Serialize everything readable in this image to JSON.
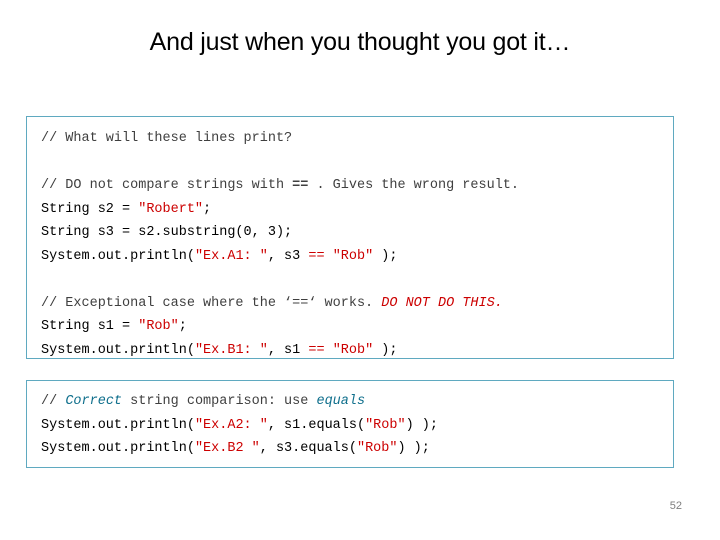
{
  "slide": {
    "title": "And just when you thought you got it…",
    "page_number": "52",
    "border_color": "#5fa9c0",
    "comment_color": "#1f7a1f",
    "string_color": "#cc0000",
    "keyword_color": "#0f6f8c"
  },
  "code_block_1": {
    "line_1": "// What will these lines print?",
    "line_2_a": "// DO not compare strings with ",
    "line_2_b": "==",
    "line_2_c": " . Gives the wrong result.",
    "line_3_a": "String s2 = ",
    "line_3_b": "\"Robert\"",
    "line_3_c": ";",
    "line_4": "String s3 = s2.substring(0, 3);",
    "line_5_a": "System.out.println(",
    "line_5_b": "\"Ex.A1: \"",
    "line_5_c": ", s3 ",
    "line_5_d": "==",
    "line_5_e": " ",
    "line_5_f": "\"Rob\"",
    "line_5_g": " );",
    "line_6_a": "// Exceptional case where the ‘==‘ works. ",
    "line_6_b": "DO NOT DO THIS.",
    "line_7_a": "String s1 = ",
    "line_7_b": "\"Rob\"",
    "line_7_c": ";",
    "line_8_a": "System.out.println(",
    "line_8_b": "\"Ex.B1: \"",
    "line_8_c": ", s1 ",
    "line_8_d": "==",
    "line_8_e": " ",
    "line_8_f": "\"Rob\"",
    "line_8_g": " );"
  },
  "code_block_2": {
    "line_1_a": "// ",
    "line_1_b": "Correct",
    "line_1_c": " string comparison: use ",
    "line_1_d": "equals",
    "line_2_a": "System.out.println(",
    "line_2_b": "\"Ex.A2: \"",
    "line_2_c": ", s1.equals(",
    "line_2_d": "\"Rob\"",
    "line_2_e": ") );",
    "line_3_a": "System.out.println(",
    "line_3_b": "\"Ex.B2 \"",
    "line_3_c": ", s3.equals(",
    "line_3_d": "\"Rob\"",
    "line_3_e": ") );"
  }
}
